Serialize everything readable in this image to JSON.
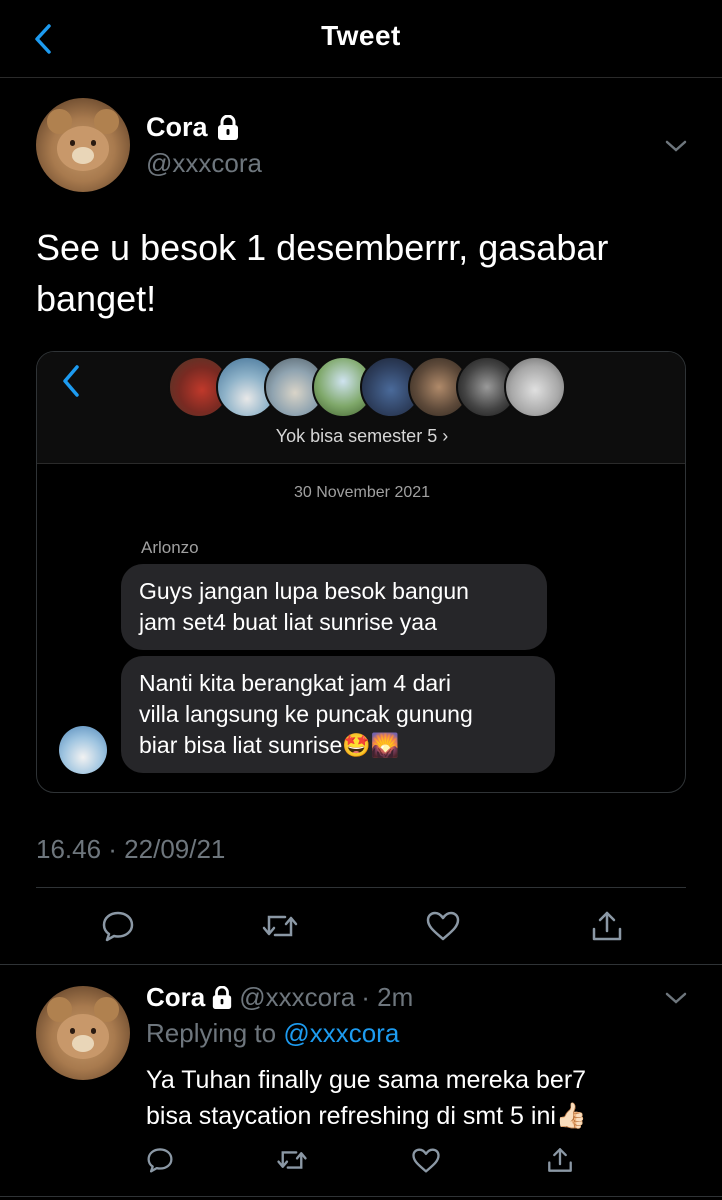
{
  "header": {
    "title": "Tweet"
  },
  "tweet": {
    "author_name": "Cora",
    "author_handle": "@xxxcora",
    "text_line1": "See u besok 1 desemberrr, gasabar",
    "text_line2": "banget!",
    "timestamp": "16.46 · 22/09/21"
  },
  "embedded_chat": {
    "group_name": "Yok bisa semester 5 ›",
    "date": "30 November 2021",
    "sender": "Arlonzo",
    "messages": [
      {
        "line1": "Guys jangan lupa besok bangun",
        "line2": "jam set4 buat liat sunrise yaa"
      },
      {
        "line1": "Nanti kita berangkat jam 4 dari",
        "line2": "villa langsung ke puncak gunung",
        "line3": "biar bisa liat sunrise🤩🌄"
      }
    ]
  },
  "reply": {
    "author_name": "Cora",
    "author_handle": "@xxxcora",
    "time": "· 2m",
    "replying_label": "Replying to",
    "replying_handle": "@xxxcora",
    "text_line1": "Ya Tuhan finally gue sama mereka ber7",
    "text_line2": "bisa staycation refreshing di smt 5 ini👍🏻"
  },
  "icons": {
    "back": "chevron-left-icon",
    "lock": "lock-icon",
    "more": "chevron-down-icon",
    "reply": "comment-icon",
    "retweet": "retweet-icon",
    "like": "heart-icon",
    "share": "share-icon"
  },
  "colors": {
    "background": "#000000",
    "accent": "#1d9bf0",
    "secondary_text": "#6e767d",
    "bubble": "#262629"
  }
}
